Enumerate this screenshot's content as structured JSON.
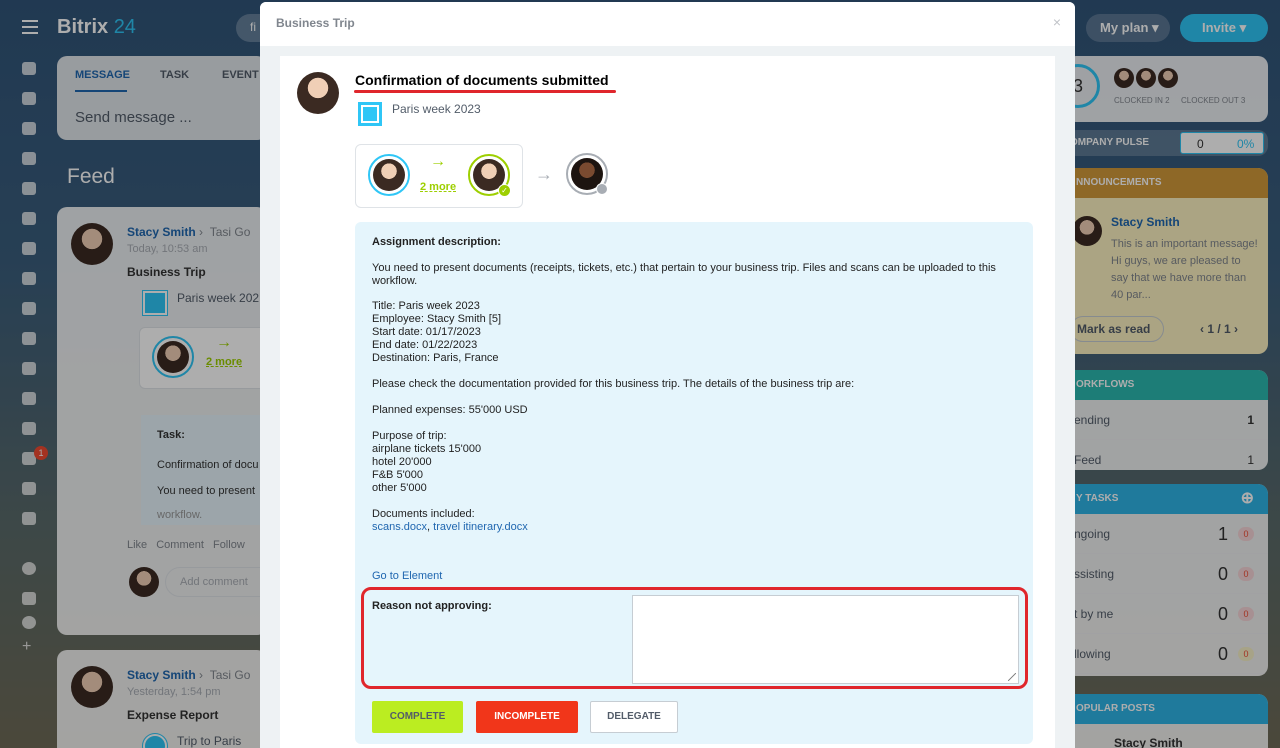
{
  "app": {
    "logo_name": "Bitrix",
    "logo_num": "24",
    "my_plan": "My plan ▾",
    "invite": "Invite ▾",
    "search_prefix": "fi"
  },
  "composer": {
    "tabs": [
      "MESSAGE",
      "TASK",
      "EVENT"
    ],
    "placeholder": "Send message ..."
  },
  "feed": {
    "title": "Feed",
    "post1": {
      "author": "Stacy Smith",
      "target": "Tasi Go",
      "time": "Today, 10:53 am",
      "title": "Business Trip",
      "doc": "Paris week 202",
      "more": "2 more",
      "task_label": "Task:",
      "task_line1": "Confirmation of docu",
      "task_line2": "You need to present",
      "task_line3": "workflow.",
      "actions": "Like Comment Follow",
      "add_comment": "Add comment"
    },
    "post2": {
      "author": "Stacy Smith",
      "target": "Tasi Go",
      "time": "Yesterday, 1:54 pm",
      "title": "Expense Report",
      "doc": "Trip to Paris"
    }
  },
  "sidebar_badge": "1",
  "right": {
    "clock_number": "3",
    "clocked_in": "CLOCKED IN 2",
    "clocked_out": "CLOCKED OUT 3",
    "pulse_label": "OMPANY PULSE",
    "pulse_value": "0",
    "pulse_pct": "0%",
    "announcements_label": "NNOUNCEMENTS",
    "ann_author": "Stacy Smith",
    "ann_text": "This is an important message! Hi guys, we are pleased to say that we have more than 40 par...",
    "mark_read": "Mark as read",
    "ann_pager": "1 / 1",
    "workflows_label": "ORKFLOWS",
    "wf_rows": [
      {
        "label": "ending",
        "count": "1"
      },
      {
        "label": "Feed",
        "count": "1"
      }
    ],
    "tasks_label": "Y TASKS",
    "task_rows": [
      {
        "label": "ngoing",
        "value": "1",
        "pill": "0"
      },
      {
        "label": "ssisting",
        "value": "0",
        "pill": "0"
      },
      {
        "label": "t by me",
        "value": "0",
        "pill": "0"
      },
      {
        "label": "llowing",
        "value": "0",
        "pill": "0"
      }
    ],
    "popular_label": "OPULAR POSTS",
    "popular_author": "Stacy Smith"
  },
  "modal": {
    "header": "Business Trip",
    "close": "×",
    "title": "Confirmation of documents submitted",
    "doc": "Paris week 2023",
    "more": "2 more",
    "description_label": "Assignment description:",
    "intro": "You need to present documents (receipts, tickets, etc.) that pertain to your business trip. Files and scans can be uploaded to this workflow.",
    "trip_lines": [
      "Title: Paris week 2023",
      "Employee: Stacy Smith [5]",
      "Start date: 01/17/2023",
      "End date: 01/22/2023",
      "Destination: Paris, France"
    ],
    "check_text": "Please check the documentation provided for this business trip. The details of the business trip are:",
    "planned": "Planned expenses: 55'000 USD",
    "purpose_lines": [
      "Purpose of trip:",
      "airplane tickets 15'000",
      "hotel 20'000",
      "F&B 5'000",
      "other 5'000"
    ],
    "docs_label": "Documents included:",
    "doc_link1": "scans.docx",
    "doc_sep": ", ",
    "doc_link2": "travel itinerary.docx",
    "go_to": "Go to Element",
    "reason_label": "Reason not approving:",
    "reason_value": "",
    "buttons": {
      "complete": "COMPLETE",
      "incomplete": "INCOMPLETE",
      "delegate": "DELEGATE"
    }
  },
  "colors": {
    "accent_blue": "#2fc6f6",
    "link": "#2067b0",
    "green": "#9dcf00",
    "red": "#e0262c",
    "complete_btn": "#bbed21",
    "incomplete_btn": "#f1361a"
  }
}
